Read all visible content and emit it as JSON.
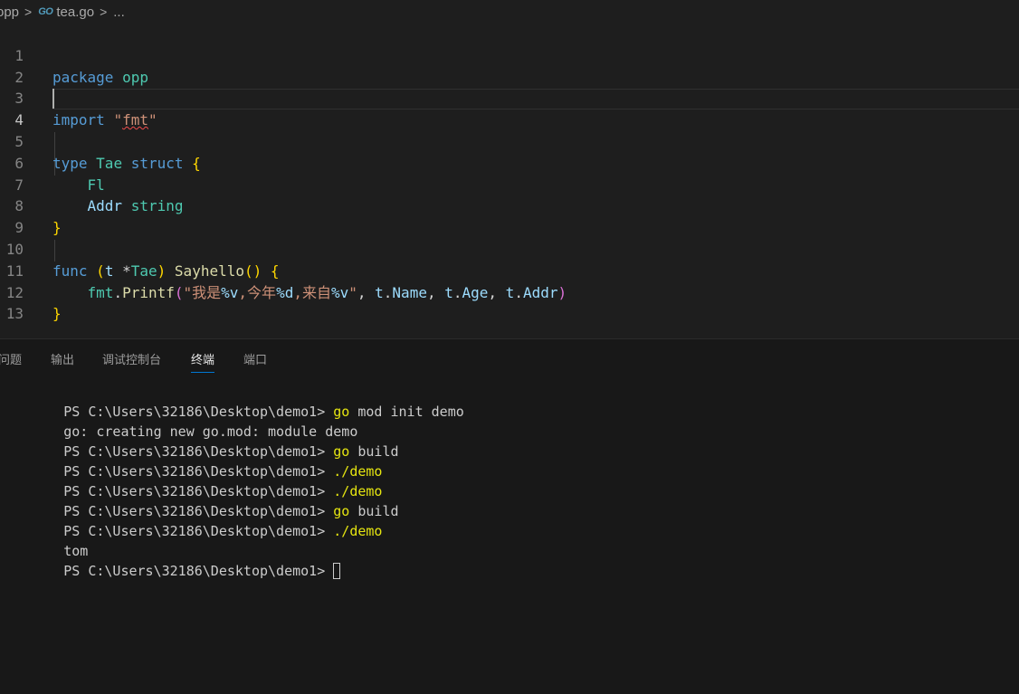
{
  "breadcrumb": {
    "folder": "opp",
    "file_icon": "go-file-icon",
    "file_icon_text": "GO",
    "file": "tea.go",
    "symbol": "...",
    "separator": ">"
  },
  "editor": {
    "active_line": 4,
    "lines": [
      {
        "n": "1"
      },
      {
        "n": "2"
      },
      {
        "n": "3"
      },
      {
        "n": "4"
      },
      {
        "n": "5"
      },
      {
        "n": "6"
      },
      {
        "n": "7"
      },
      {
        "n": "8"
      },
      {
        "n": "9"
      },
      {
        "n": "10"
      },
      {
        "n": "11"
      },
      {
        "n": "12"
      },
      {
        "n": "13"
      }
    ],
    "code": {
      "l1": {
        "kw": "package",
        "name": "opp"
      },
      "l3": {
        "kw": "import",
        "q1": "\"",
        "path": "fmt",
        "q2": "\""
      },
      "l5": {
        "kw": "type",
        "name": "Tae",
        "kw2": "struct",
        "brace": "{"
      },
      "l6": {
        "field": "Fl"
      },
      "l7": {
        "field": "Addr",
        "type": "string"
      },
      "l8": {
        "brace": "}"
      },
      "l10": {
        "kw": "func",
        "p1": "(",
        "recv": "t",
        "star": "*",
        "recv_type": "Tae",
        "p2": ")",
        "fn": "Sayhello",
        "call": "()",
        "brace": "{"
      },
      "l11": {
        "pkg": "fmt",
        "dot": ".",
        "fn": "Printf",
        "p1": "(",
        "s1": "\"我是",
        "f1": "%v",
        "s2": ",今年",
        "f2": "%d",
        "s3": ",来自",
        "f3": "%v",
        "s4": "\"",
        "c1": ", ",
        "a1": "t",
        "d1": ".",
        "b1": "Name",
        "c2": ", ",
        "a2": "t",
        "d2": ".",
        "b2": "Age",
        "c3": ", ",
        "a3": "t",
        "d3": ".",
        "b3": "Addr",
        "p2": ")"
      },
      "l12": {
        "brace": "}"
      }
    }
  },
  "panel": {
    "tabs": [
      {
        "label": "问题",
        "active": false
      },
      {
        "label": "输出",
        "active": false
      },
      {
        "label": "调试控制台",
        "active": false
      },
      {
        "label": "终端",
        "active": true
      },
      {
        "label": "端口",
        "active": false
      }
    ]
  },
  "terminal": {
    "prompt": "PS C:\\Users\\32186\\Desktop\\demo1> ",
    "lines": [
      {
        "cmd": "go",
        "args": " mod init demo"
      },
      {
        "output": "go: creating new go.mod: module demo"
      },
      {
        "cmd": "go",
        "args": " build"
      },
      {
        "cmd": "./demo",
        "args": ""
      },
      {
        "cmd": "./demo",
        "args": ""
      },
      {
        "cmd": "go",
        "args": " build"
      },
      {
        "cmd": "./demo",
        "args": ""
      },
      {
        "output": "tom"
      },
      {
        "cmd": "",
        "args": ""
      }
    ]
  },
  "colors": {
    "editor_bg": "#1e1e1e",
    "panel_bg": "#181818",
    "keyword": "#569cd6",
    "type": "#4ec9b0",
    "string": "#ce9178",
    "function": "#dcdcaa",
    "variable": "#9cdcfe",
    "terminal_command": "#e5e510",
    "active_tab_underline": "#0078d4"
  }
}
